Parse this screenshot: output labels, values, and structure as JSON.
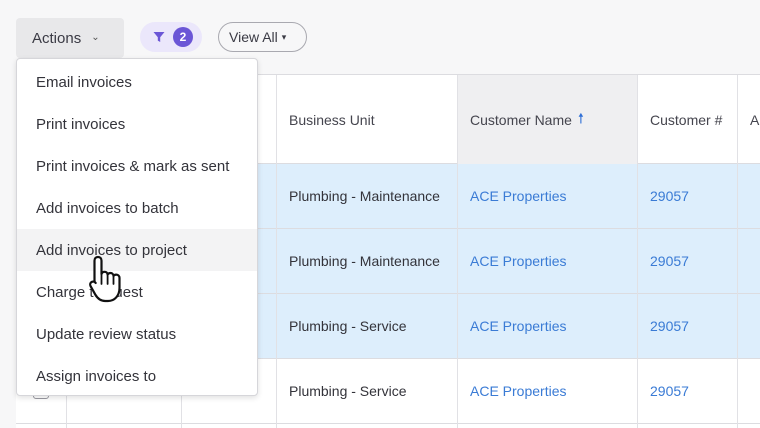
{
  "toolbar": {
    "actions_label": "Actions",
    "filter_count": "2",
    "view_label": "View All"
  },
  "table": {
    "columns": [
      {
        "label": ""
      },
      {
        "label": ""
      },
      {
        "label": ""
      },
      {
        "label": "Business Unit"
      },
      {
        "label": "Customer Name",
        "sort": "ascending"
      },
      {
        "label": "Customer #"
      },
      {
        "label": "A"
      }
    ],
    "rows": [
      {
        "business_unit": "Plumbing - Maintenance",
        "customer_name": "ACE Properties",
        "customer_number": "29057",
        "selected": true
      },
      {
        "business_unit": "Plumbing - Maintenance",
        "customer_name": "ACE Properties",
        "customer_number": "29057",
        "selected": true
      },
      {
        "business_unit": "Plumbing - Service",
        "customer_name": "ACE Properties",
        "customer_number": "29057",
        "selected": true
      },
      {
        "business_unit": "Plumbing - Service",
        "customer_name": "ACE Properties",
        "customer_number": "29057",
        "selected": false
      }
    ]
  },
  "menu": {
    "items": [
      {
        "label": "Email invoices"
      },
      {
        "label": "Print invoices"
      },
      {
        "label": "Print invoices & mark as sent"
      },
      {
        "label": "Add invoices to batch"
      },
      {
        "label": "Add invoices to project",
        "hovered": true
      },
      {
        "label": "Charge to guest"
      },
      {
        "label": "Update review status"
      },
      {
        "label": "Assign invoices to"
      }
    ]
  },
  "colors": {
    "accent": "#6b56d6",
    "link": "#3a7bd5",
    "sort_arrow": "#2f6fd6",
    "selected_row": "#ddeefc"
  },
  "icons": {
    "filter": "filter-funnel-icon",
    "chevron": "chevron-down-icon",
    "sort": "sort-ascending-arrow-icon",
    "cursor": "hand-pointer-cursor-icon"
  }
}
